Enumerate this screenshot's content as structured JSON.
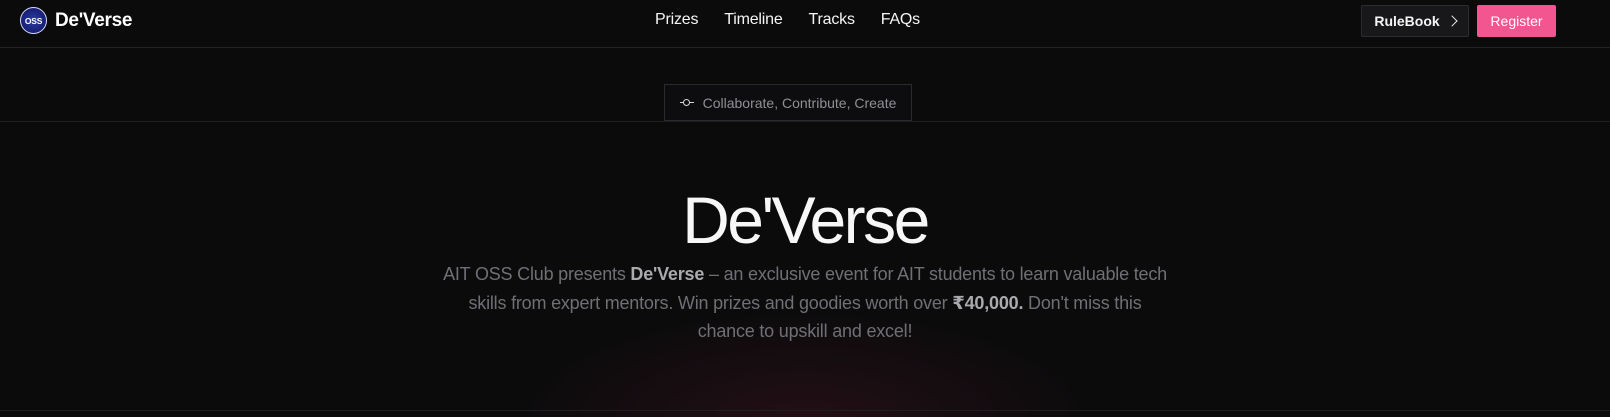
{
  "brand": {
    "logo_text": "OSS",
    "name": "De'Verse"
  },
  "nav": {
    "links": [
      "Prizes",
      "Timeline",
      "Tracks",
      "FAQs"
    ]
  },
  "actions": {
    "rulebook_label": "RuleBook",
    "register_label": "Register",
    "register_color": "#f2558f"
  },
  "badge": {
    "text": "Collaborate, Contribute, Create",
    "icon": "git-commit-icon"
  },
  "hero": {
    "title": "De'Verse",
    "desc_part1": "AIT OSS Club presents ",
    "desc_strong1": "De'Verse",
    "desc_part2": " – an exclusive event for AIT students to learn valuable tech skills from expert mentors. Win prizes and goodies worth over ",
    "desc_strong2": "₹40,000.",
    "desc_part3": " Don't miss this chance to upskill and excel!"
  }
}
